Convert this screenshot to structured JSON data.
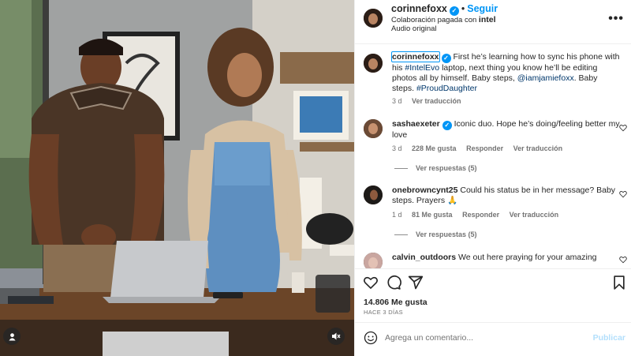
{
  "header": {
    "username": "corinnefoxx",
    "separator": "•",
    "follow_label": "Seguir",
    "partnership_prefix": "Colaboración pagada con",
    "partner": "intel",
    "audio": "Audio original",
    "more_icon": "more-horizontal-icon"
  },
  "caption": {
    "username": "corinnefoxx",
    "text_1": "First he’s learning how to sync his phone with his",
    "tag_1": "#IntelEvo",
    "text_2": "laptop, next thing you know he’ll be editing photos all by himself. Baby steps,",
    "mention": "@iamjamiefoxx",
    "text_3": ". Baby steps.",
    "tag_2": "#ProudDaughter",
    "time": "3 d",
    "translate": "Ver traducción"
  },
  "comments": [
    {
      "username": "sashaexeter",
      "verified": true,
      "text": "Iconic duo. Hope he’s doing/feeling better my love",
      "time": "3 d",
      "likes": "228 Me gusta",
      "reply": "Responder",
      "translate": "Ver traducción",
      "replies": "Ver respuestas (5)"
    },
    {
      "username": "onebrowncynt25",
      "verified": false,
      "text": "Could his status be in her message? Baby steps. Prayers 🙏",
      "time": "1 d",
      "likes": "81 Me gusta",
      "reply": "Responder",
      "translate": "Ver traducción",
      "replies": "Ver respuestas (5)"
    },
    {
      "username": "calvin_outdoors",
      "verified": false,
      "text": "We out here praying for your amazing"
    }
  ],
  "actions": {
    "icons": [
      "heart-icon",
      "comment-icon",
      "share-icon",
      "bookmark-icon"
    ],
    "likes": "14.806 Me gusta",
    "posted": "HACE 3 DÍAS"
  },
  "add_comment": {
    "placeholder": "Agrega un comentario...",
    "publish_label": "Publicar"
  },
  "colors": {
    "accent": "#0095f6",
    "link": "#00376b",
    "muted": "#737373",
    "publish_disabled": "#b2dffc"
  }
}
